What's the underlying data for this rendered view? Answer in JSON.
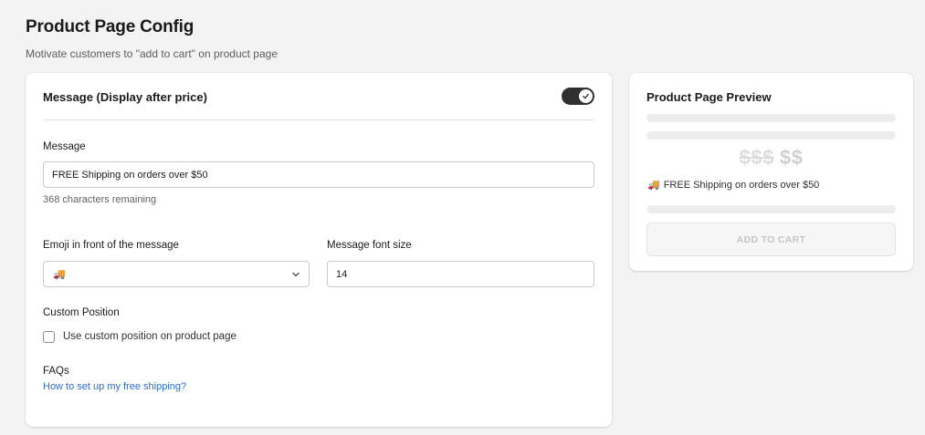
{
  "page": {
    "title": "Product Page Config",
    "subtitle": "Motivate customers to \"add to cart\" on product page"
  },
  "main_card": {
    "header_title": "Message (Display after price)",
    "toggle_enabled": true,
    "message": {
      "label": "Message",
      "value": "FREE Shipping on orders over $50",
      "help": "368 characters remaining"
    },
    "emoji": {
      "label": "Emoji in front of the message",
      "selected": "🚚"
    },
    "font_size": {
      "label": "Message font size",
      "value": "14"
    },
    "custom_position": {
      "label": "Custom Position",
      "checkbox_label": "Use custom position on product page",
      "checked": false
    },
    "faqs": {
      "label": "FAQs",
      "link_text": "How to set up my free shipping?"
    }
  },
  "preview_card": {
    "title": "Product Page Preview",
    "price_old": "$$$",
    "price_new": "$$",
    "emoji": "🚚",
    "message": "FREE Shipping on orders over $50",
    "add_to_cart_label": "ADD TO CART"
  },
  "colors": {
    "toggle_on": "#303030",
    "link": "#2c6ecb",
    "background": "#f3f3f3"
  }
}
